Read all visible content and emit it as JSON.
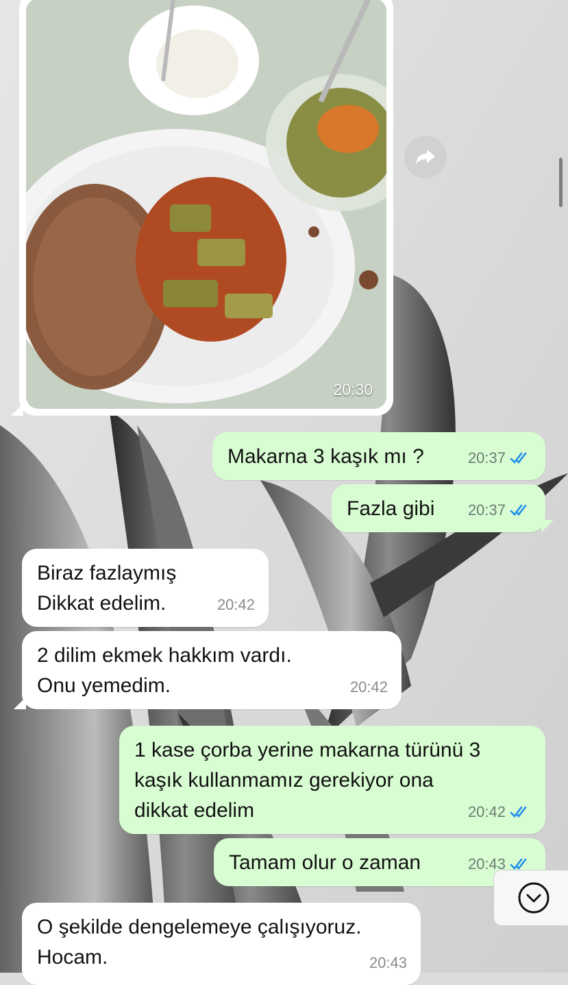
{
  "photo_message": {
    "time": "20:30"
  },
  "messages": [
    {
      "text": "Makarna 3 kaşık mı ?",
      "time": "20:37"
    },
    {
      "text": "Fazla gibi",
      "time": "20:37"
    },
    {
      "text": "Biraz fazlaymış\nDikkat edelim.",
      "time": "20:42"
    },
    {
      "text": "2 dilim ekmek hakkım vardı.\nOnu yemedim.",
      "time": "20:42"
    },
    {
      "text": "1 kase çorba yerine makarna türünü 3\nkaşık kullanmamız gerekiyor ona\ndikkat edelim",
      "time": "20:42"
    },
    {
      "text": "Tamam olur o zaman",
      "time": "20:43"
    },
    {
      "text": "O şekilde dengelemeye çalışıyoruz.\nHocam.",
      "time": "20:43"
    }
  ],
  "icons": {
    "forward": "forward-arrow-icon",
    "read_receipt": "double-check-icon",
    "scroll_down": "chevron-down-circle-icon"
  },
  "colors": {
    "incoming_bubble": "#ffffff",
    "outgoing_bubble": "#d9fdd3",
    "read_tick": "#1f8fe8"
  }
}
